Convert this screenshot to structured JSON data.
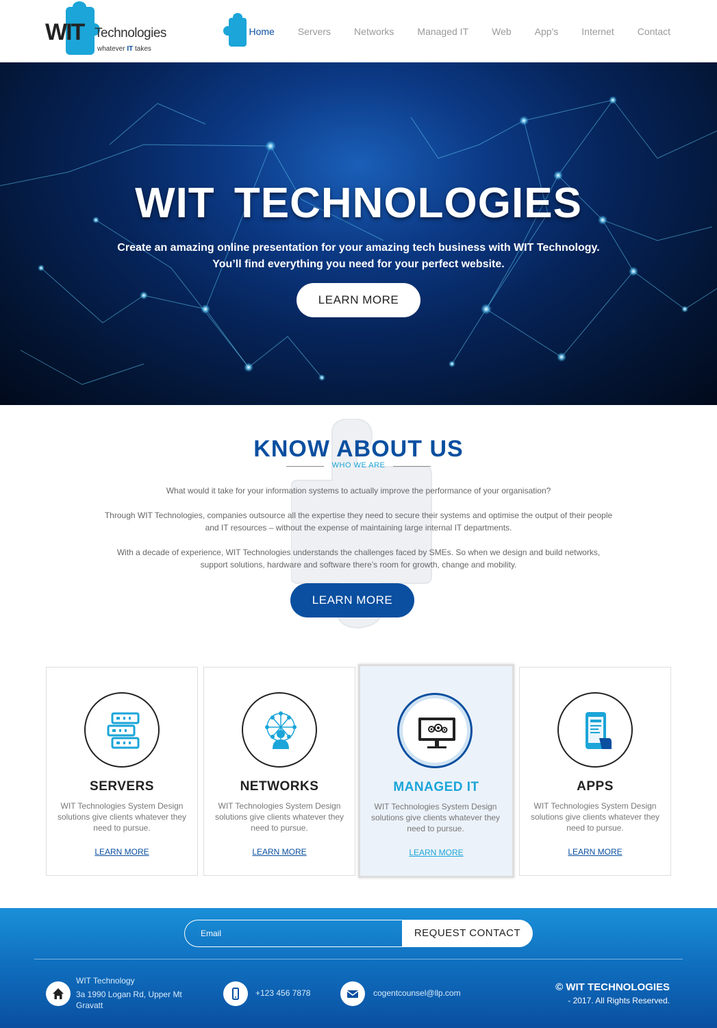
{
  "logo": {
    "main": "WIT",
    "word": "Technologies",
    "tagline_pre": "whatever ",
    "tagline_bold": "IT",
    "tagline_post": " takes"
  },
  "nav": [
    "Home",
    "Servers",
    "Networks",
    "Managed IT",
    "Web",
    "App's",
    "Internet",
    "Contact"
  ],
  "hero": {
    "title": "WIT TECHNOLOGIES",
    "subtitle_line1": "Create an amazing online presentation for your amazing tech business with WIT Technology.",
    "subtitle_line2": "You’ll find everything you need for your perfect website.",
    "button": "LEARN MORE"
  },
  "about": {
    "title": "KNOW ABOUT US",
    "subtitle": "WHO WE ARE",
    "p1": "What would it take for your information systems to actually improve the performance of your organisation?",
    "p2": "Through WIT Technologies, companies outsource all the expertise they need to secure their systems and optimise the output of their people and IT resources – without the expense of maintaining large internal IT departments.",
    "p3": "With a decade of experience, WIT Technologies understands the challenges faced by SMEs. So when we design and build networks, support solutions, hardware and software there’s room for growth, change and mobility.",
    "button": "LEARN MORE"
  },
  "services": [
    {
      "title": "SERVERS",
      "desc": "WIT Technologies System Design solutions give clients whatever they need to pursue.",
      "link": "LEARN MORE",
      "icon": "server-icon"
    },
    {
      "title": "NETWORKS",
      "desc": "WIT Technologies System Design solutions give clients whatever they need to pursue.",
      "link": "LEARN MORE",
      "icon": "network-icon"
    },
    {
      "title": "MANAGED IT",
      "desc": "WIT Technologies System Design solutions give clients whatever they need to pursue.",
      "link": "LEARN MORE",
      "icon": "monitor-gears-icon"
    },
    {
      "title": "APPS",
      "desc": "WIT Technologies System Design solutions give clients whatever they need to pursue.",
      "link": "LEARN MORE",
      "icon": "mobile-app-icon"
    }
  ],
  "footer": {
    "email_placeholder": "Email",
    "request_button": "REQUEST CONTACT",
    "company": "WIT Technology",
    "address_line1": "3a 1990 Logan Rd, Upper Mt",
    "address_line2": "Gravatt",
    "phone": "+123 456 7878",
    "email": "cogentcounsel@llp.com",
    "copyright_title": "© WIT TECHNOLOGIES",
    "copyright_sub": "- 2017. All Rights Reserved."
  },
  "colors": {
    "brand_blue": "#0a4fa0",
    "accent_cyan": "#1ba5d8"
  }
}
